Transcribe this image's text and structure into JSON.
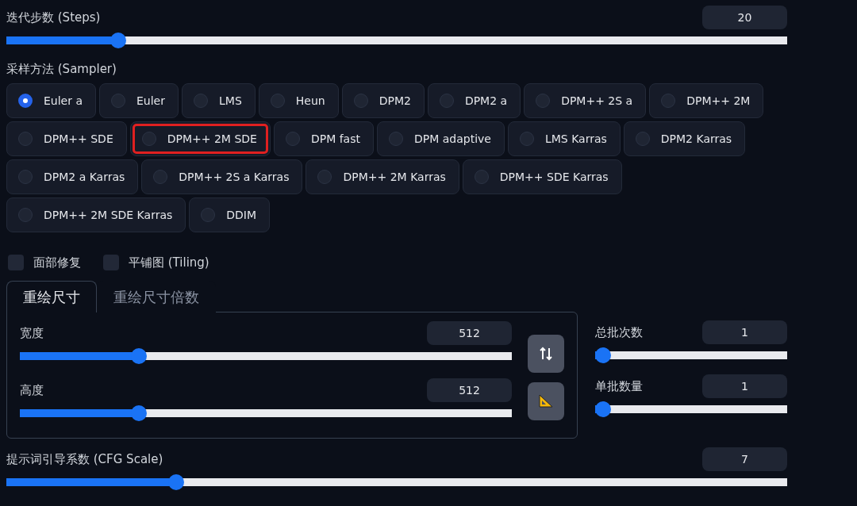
{
  "steps": {
    "label": "迭代步数 (Steps)",
    "value": "20",
    "level": 0.136
  },
  "sampler": {
    "label": "采样方法 (Sampler)",
    "options": [
      {
        "label": "Euler a",
        "selected": true,
        "highlighted": false
      },
      {
        "label": "Euler",
        "selected": false,
        "highlighted": false
      },
      {
        "label": "LMS",
        "selected": false,
        "highlighted": false
      },
      {
        "label": "Heun",
        "selected": false,
        "highlighted": false
      },
      {
        "label": "DPM2",
        "selected": false,
        "highlighted": false
      },
      {
        "label": "DPM2 a",
        "selected": false,
        "highlighted": false
      },
      {
        "label": "DPM++ 2S a",
        "selected": false,
        "highlighted": false
      },
      {
        "label": "DPM++ 2M",
        "selected": false,
        "highlighted": false
      },
      {
        "label": "DPM++ SDE",
        "selected": false,
        "highlighted": false
      },
      {
        "label": "DPM++ 2M SDE",
        "selected": false,
        "highlighted": true
      },
      {
        "label": "DPM fast",
        "selected": false,
        "highlighted": false
      },
      {
        "label": "DPM adaptive",
        "selected": false,
        "highlighted": false
      },
      {
        "label": "LMS Karras",
        "selected": false,
        "highlighted": false
      },
      {
        "label": "DPM2 Karras",
        "selected": false,
        "highlighted": false
      },
      {
        "label": "DPM2 a Karras",
        "selected": false,
        "highlighted": false
      },
      {
        "label": "DPM++ 2S a Karras",
        "selected": false,
        "highlighted": false
      },
      {
        "label": "DPM++ 2M Karras",
        "selected": false,
        "highlighted": false
      },
      {
        "label": "DPM++ SDE Karras",
        "selected": false,
        "highlighted": false
      },
      {
        "label": "DPM++ 2M SDE Karras",
        "selected": false,
        "highlighted": false
      },
      {
        "label": "DDIM",
        "selected": false,
        "highlighted": false
      }
    ]
  },
  "checkboxes": [
    {
      "label": "面部修复",
      "checked": false
    },
    {
      "label": "平铺图 (Tiling)",
      "checked": false
    }
  ],
  "size_tabs": [
    {
      "label": "重绘尺寸",
      "selected": true
    },
    {
      "label": "重绘尺寸倍数",
      "selected": false
    }
  ],
  "size_sliders": [
    {
      "label": "宽度",
      "value": "512",
      "level": 0.234
    },
    {
      "label": "高度",
      "value": "512",
      "level": 0.234
    }
  ],
  "size_buttons": [
    {
      "kind": "swap"
    },
    {
      "kind": "ruler"
    }
  ],
  "batch_sliders": [
    {
      "label": "总批次数",
      "value": "1",
      "level": 0
    },
    {
      "label": "单批数量",
      "value": "1",
      "level": 0
    }
  ],
  "cfg": {
    "label": "提示词引导系数 (CFG Scale)",
    "value": "7",
    "level": 0.212
  }
}
